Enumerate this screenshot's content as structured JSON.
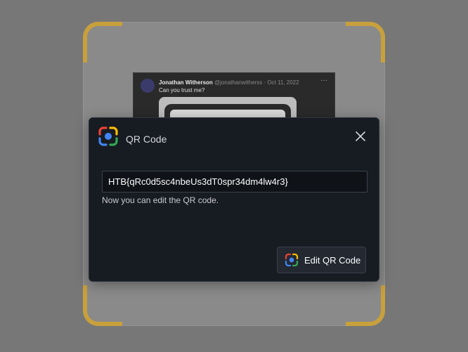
{
  "colors": {
    "corner_accent": "#c8a03c",
    "dialog_bg": "#171b22",
    "lens_blue": "#4285f4",
    "lens_red": "#ea4335",
    "lens_yellow": "#fbbc05",
    "lens_green": "#34a853"
  },
  "tweet": {
    "author_name": "Jonathan Witherson",
    "author_meta": "@jonathanwitherss · Oct 11, 2022",
    "text": "Can you trust me?",
    "more_icon": "ellipsis-icon"
  },
  "dialog": {
    "icon": "google-lens-icon",
    "title": "QR Code",
    "close_icon": "close-icon",
    "qr_value": "HTB{qRc0d5sc4nbeUs3dT0spr34dm4lw4r3}",
    "hint": "Now you can edit the QR code.",
    "edit_button_label": "Edit QR Code"
  }
}
